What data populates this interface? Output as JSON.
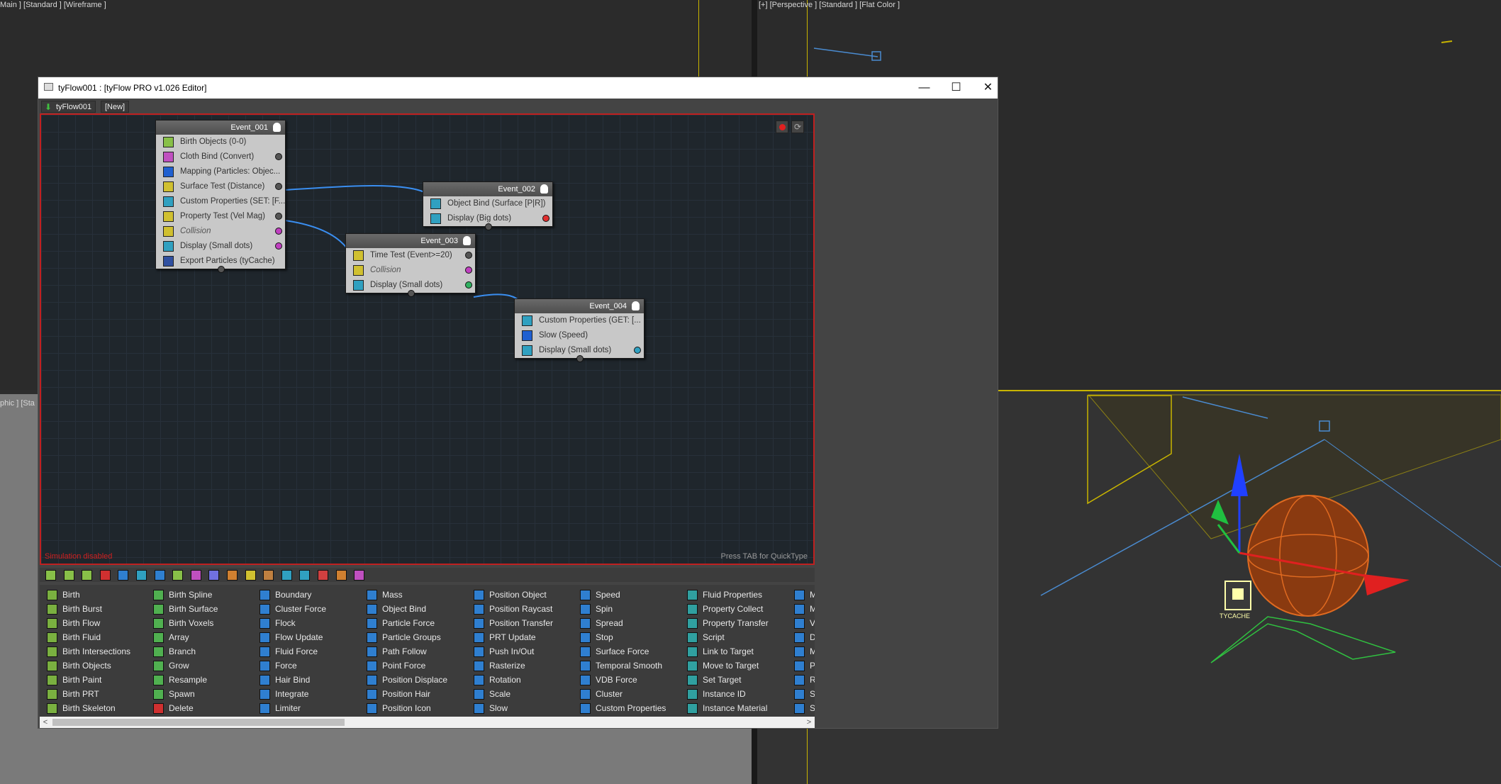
{
  "viewports": {
    "top_left_label": "Main ] [Standard ] [Wireframe ]",
    "top_right_label": "[+] [Perspective ] [Standard ] [Flat Color ]",
    "mid_left_label": "phic ] [Sta",
    "tycache_label": "TYCACHE"
  },
  "window": {
    "title": "tyFlow001 : [tyFlow PRO v1.026 Editor]",
    "minimize": "—",
    "maximize": "☐",
    "close": "✕"
  },
  "tabs": [
    {
      "label": "tyFlow001"
    },
    {
      "label": "[New]"
    }
  ],
  "canvas": {
    "status_left": "Simulation disabled",
    "status_right": "Press TAB for QuickType"
  },
  "events": [
    {
      "name": "Event_001",
      "operators": [
        {
          "label": "Birth Objects (0-0)",
          "icon_color": "#88c048",
          "port": null
        },
        {
          "label": "Cloth Bind (Convert)",
          "icon_color": "#c050c0",
          "port": "#555555"
        },
        {
          "label": "Mapping (Particles: Objec...",
          "icon_color": "#2060d0",
          "port": null
        },
        {
          "label": "Surface Test (Distance)",
          "icon_color": "#d0c030",
          "port": "#555555"
        },
        {
          "label": "Custom Properties (SET: [F...",
          "icon_color": "#30a0c0",
          "port": null
        },
        {
          "label": "Property Test (Vel Mag)",
          "icon_color": "#d0c030",
          "port": "#555555"
        },
        {
          "label": "Collision",
          "icon_color": "#d0c030",
          "port": "#c040c0",
          "italic": true
        },
        {
          "label": "Display (Small dots)",
          "icon_color": "#30a0c0",
          "port": "#c040c0"
        },
        {
          "label": "Export Particles (tyCache)",
          "icon_color": "#3050a0",
          "port": null
        }
      ]
    },
    {
      "name": "Event_002",
      "operators": [
        {
          "label": "Object Bind (Surface [P|R])",
          "icon_color": "#30a0c0",
          "port": null
        },
        {
          "label": "Display (Big dots)",
          "icon_color": "#30a0c0",
          "port": "#e03030"
        }
      ]
    },
    {
      "name": "Event_003",
      "operators": [
        {
          "label": "Time Test (Event>=20)",
          "icon_color": "#d0c030",
          "port": "#555555"
        },
        {
          "label": "Collision",
          "icon_color": "#d0c030",
          "port": "#c040c0",
          "italic": true
        },
        {
          "label": "Display (Small dots)",
          "icon_color": "#30a0c0",
          "port": "#30b060"
        }
      ]
    },
    {
      "name": "Event_004",
      "operators": [
        {
          "label": "Custom Properties (GET: [...",
          "icon_color": "#30a0c0",
          "port": null
        },
        {
          "label": "Slow (Speed)",
          "icon_color": "#2060d0",
          "port": null
        },
        {
          "label": "Display (Small dots)",
          "icon_color": "#30a0c0",
          "port": "#30a0c0"
        }
      ]
    }
  ],
  "palette": {
    "columns": [
      {
        "icon_color": "#7ab040",
        "items": [
          "Birth",
          "Birth Burst",
          "Birth Flow",
          "Birth Fluid",
          "Birth Intersections",
          "Birth Objects",
          "Birth Paint",
          "Birth PRT",
          "Birth Skeleton"
        ]
      },
      {
        "icon_color": "#50b050",
        "items": [
          "Birth Spline",
          "Birth Surface",
          "Birth Voxels",
          "Array",
          "Branch",
          "Grow",
          "Resample",
          "Spawn",
          "Delete"
        ]
      },
      {
        "icon_color": "#2f7fd0",
        "items": [
          "Boundary",
          "Cluster Force",
          "Flock",
          "Flow Update",
          "Fluid Force",
          "Force",
          "Hair Bind",
          "Integrate",
          "Limiter"
        ]
      },
      {
        "icon_color": "#2f7fd0",
        "items": [
          "Mass",
          "Object Bind",
          "Particle Force",
          "Particle Groups",
          "Path Follow",
          "Point Force",
          "Position Displace",
          "Position Hair",
          "Position Icon"
        ]
      },
      {
        "icon_color": "#2f7fd0",
        "items": [
          "Position Object",
          "Position Raycast",
          "Position Transfer",
          "PRT Update",
          "Push In/Out",
          "Rasterize",
          "Rotation",
          "Scale",
          "Slow"
        ]
      },
      {
        "icon_color": "#2f7fd0",
        "items": [
          "Speed",
          "Spin",
          "Spread",
          "Stop",
          "Surface Force",
          "Temporal Smooth",
          "VDB Force",
          "Cluster",
          "Custom Properties"
        ]
      },
      {
        "icon_color": "#30a0a0",
        "items": [
          "Fluid Properties",
          "Property Collect",
          "Property Transfer",
          "Script",
          "Link to Target",
          "Move to Target",
          "Set Target",
          "Instance ID",
          "Instance Material"
        ]
      },
      {
        "icon_color": "#2f7fd0",
        "items": [
          "M",
          "M",
          "Vi",
          "D",
          "M",
          "P",
          "R",
          "Sl",
          "Sl"
        ]
      }
    ]
  },
  "toolbar_icon_colors": [
    "#88c048",
    "#88c048",
    "#88c048",
    "#d03030",
    "#2f7fd0",
    "#30a0c0",
    "#2f7fd0",
    "#88c048",
    "#c050c0",
    "#7070e0",
    "#d08030",
    "#d0c030",
    "#c08040",
    "#30a0c0",
    "#30a0c0",
    "#d04040",
    "#d08030",
    "#c050c0"
  ]
}
